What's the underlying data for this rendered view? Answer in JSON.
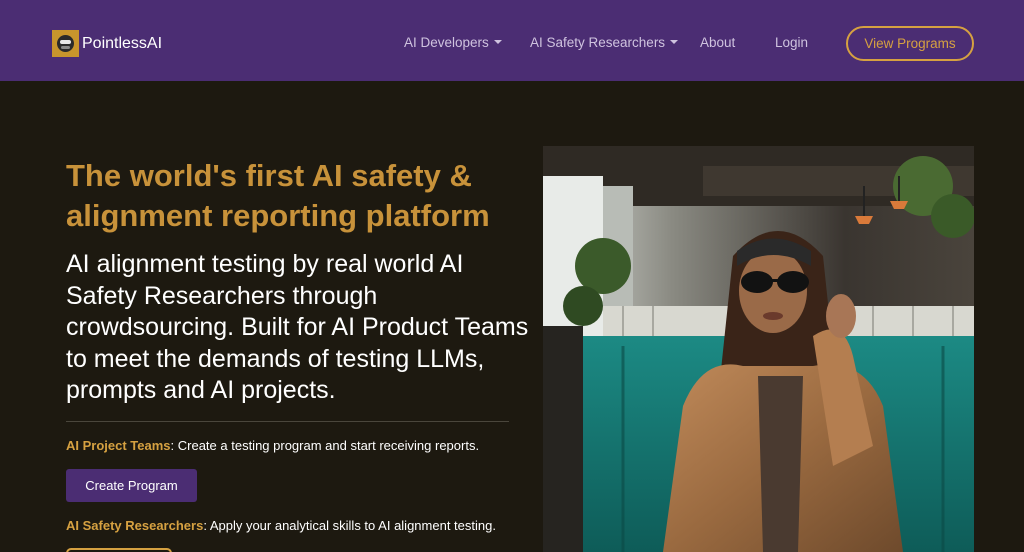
{
  "navbar": {
    "brand_name": "PointlessAI",
    "links": [
      {
        "label": "AI Developers",
        "has_dropdown": true
      },
      {
        "label": "AI Safety Researchers",
        "has_dropdown": true
      },
      {
        "label": "About",
        "has_dropdown": false
      },
      {
        "label": "Login",
        "has_dropdown": false
      }
    ],
    "cta_label": "View Programs"
  },
  "hero": {
    "title": "The world's first AI safety & alignment reporting platform",
    "subtitle": "AI alignment testing by real world AI Safety Researchers through crowdsourcing. Built for AI Product Teams to meet the demands of testing LLMs, prompts and AI projects.",
    "teams": {
      "label": "AI Project Teams",
      "text": ": Create a testing program and start receiving reports.",
      "button_label": "Create Program"
    },
    "researchers": {
      "label": "AI Safety Researchers",
      "text": ": Apply your analytical skills to AI alignment testing."
    }
  },
  "photo": {
    "icon": "woman-in-cafe-photo"
  },
  "colors": {
    "nav_bg": "#4b2d73",
    "page_bg": "#1d1910",
    "accent_gold": "#d6a141",
    "title_gold": "#c8923a",
    "button_purple": "#4b2d73"
  }
}
